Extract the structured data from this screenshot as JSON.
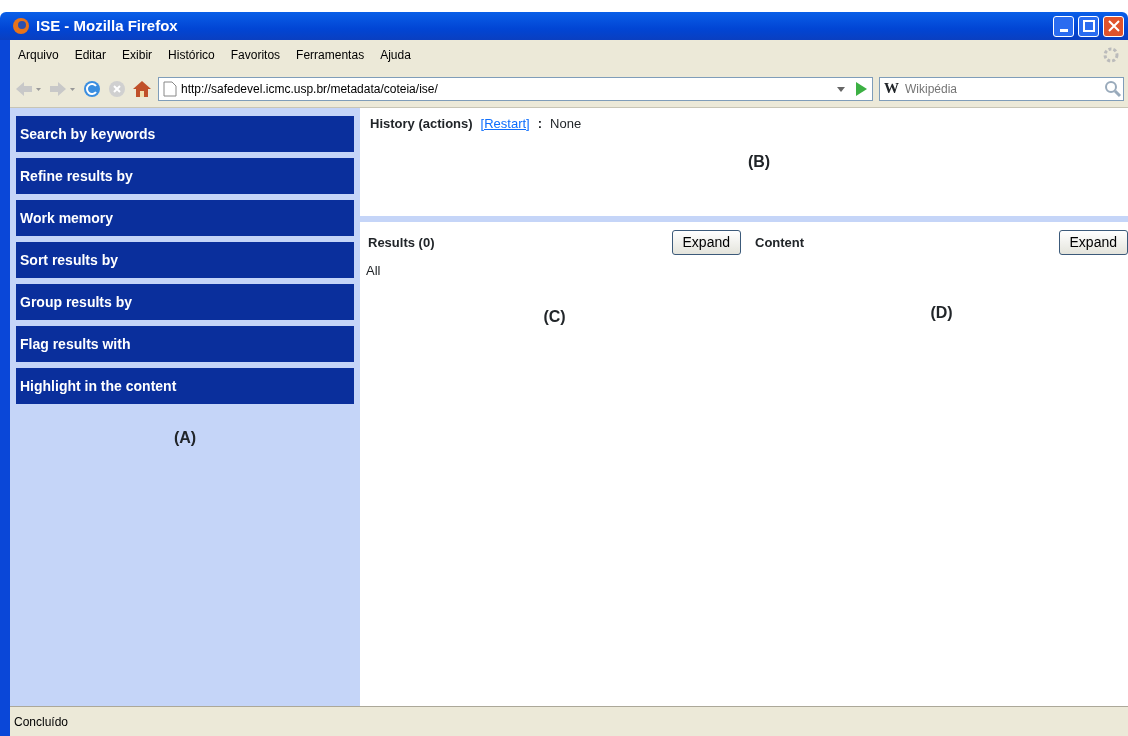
{
  "window": {
    "title": "ISE - Mozilla Firefox"
  },
  "menu": [
    "Arquivo",
    "Editar",
    "Exibir",
    "Histórico",
    "Favoritos",
    "Ferramentas",
    "Ajuda"
  ],
  "address": {
    "value": "http://safedevel.icmc.usp.br/metadata/coteia/ise/"
  },
  "search": {
    "engine": "W",
    "placeholder": "Wikipédia"
  },
  "sidebar": {
    "items": [
      "Search by keywords",
      "Refine results by",
      "Work memory",
      "Sort results by",
      "Group results by",
      "Flag results with",
      "Highlight in the content"
    ],
    "label": "(A)"
  },
  "history": {
    "title": "History (actions)",
    "link": "[Restart]",
    "separator": ":",
    "value": "None",
    "label": "(B)"
  },
  "results": {
    "title": "Results (0)",
    "button": "Expand",
    "filter": "All",
    "label": "(C)"
  },
  "content": {
    "title": "Content",
    "button": "Expand",
    "label": "(D)"
  },
  "status_bar": "Concluído"
}
